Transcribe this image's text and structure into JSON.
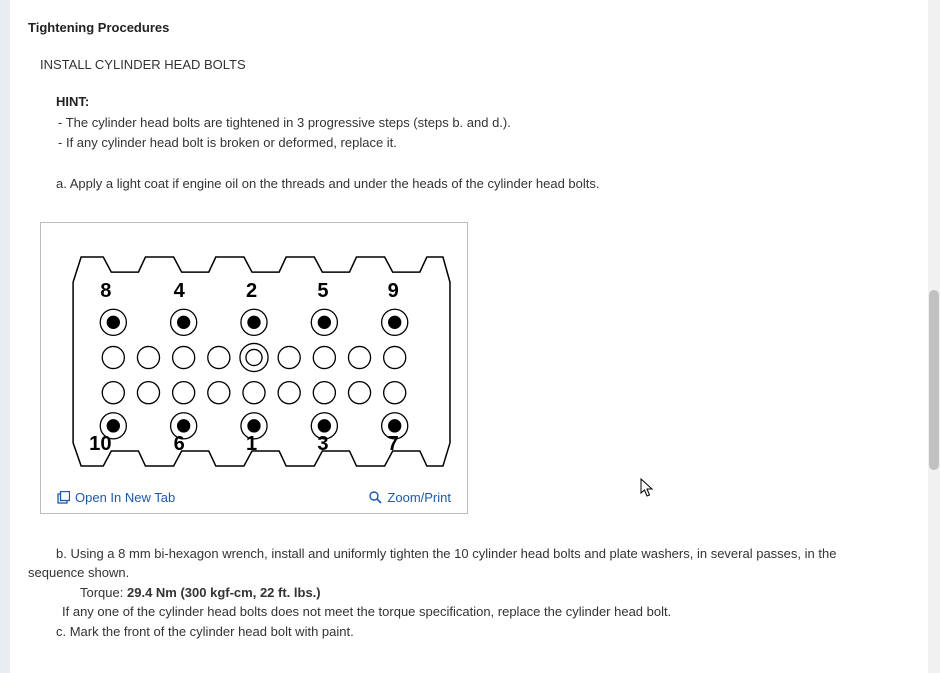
{
  "title": "Tightening Procedures",
  "subtitle": "INSTALL CYLINDER HEAD BOLTS",
  "hint_label": "HINT:",
  "hints": [
    "The cylinder head bolts are tightened in 3 progressive steps (steps b. and d.).",
    "If any cylinder head bolt is broken or deformed, replace it."
  ],
  "step_a": "a. Apply a light coat if engine oil on the threads and under the heads of the cylinder head bolts.",
  "diagram": {
    "bolt_sequence_top": [
      "8",
      "4",
      "2",
      "5",
      "9"
    ],
    "bolt_sequence_bottom": [
      "10",
      "6",
      "1",
      "3",
      "7"
    ],
    "open_new_tab": "Open In New Tab",
    "zoom_print": "Zoom/Print"
  },
  "step_b_first": "b. Using a 8 mm bi-hexagon wrench, install and uniformly tighten the 10 cylinder head bolts and plate washers, in several passes, in the",
  "step_b_continue": "sequence shown.",
  "torque_label": "Torque:",
  "torque_value": "29.4 Nm (300 kgf-cm, 22 ft. lbs.)",
  "replace_note": "If any one of the cylinder head bolts does not meet the torque specification, replace the cylinder head bolt.",
  "step_c": "c. Mark the front of the cylinder head bolt with paint."
}
